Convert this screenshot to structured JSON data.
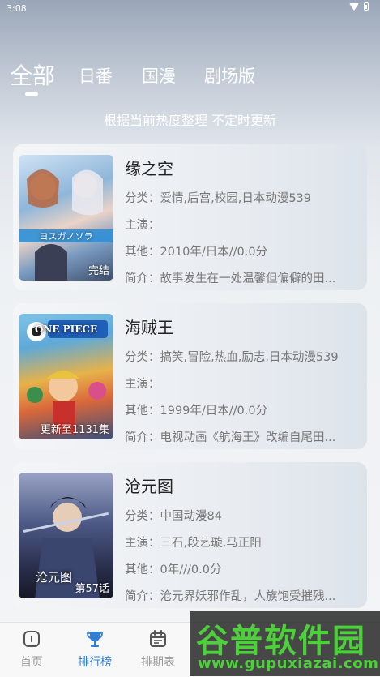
{
  "status_bar": {
    "time": "3:08"
  },
  "tabs": [
    {
      "label": "全部",
      "active": true
    },
    {
      "label": "日番",
      "active": false
    },
    {
      "label": "国漫",
      "active": false
    },
    {
      "label": "剧场版",
      "active": false
    }
  ],
  "subtitle": "根据当前热度整理 不定时更新",
  "items": [
    {
      "title": "缘之空",
      "poster_badge": "完结",
      "poster_text": "ヨスガノソラ",
      "category": "分类：爱情,后宫,校园,日本动漫539",
      "cast": "主演：",
      "other": "其他：2010年/日本//0.0分",
      "summary": "简介：故事发生在一处温馨但偏僻的田..."
    },
    {
      "title": "海贼王",
      "poster_badge": "更新至1131集",
      "poster_text": "ONE PIECE",
      "category": "分类：搞笑,冒险,热血,励志,日本动漫539",
      "cast": "主演：",
      "other": "其他：1999年/日本//0.0分",
      "summary": "简介：电视动画《航海王》改编自尾田..."
    },
    {
      "title": "沧元图",
      "poster_badge": "第57话",
      "poster_text": "沧元图",
      "category": "分类：中国动漫84",
      "cast": "主演：三石,段艺璇,马正阳",
      "other": "其他：0年///0.0分",
      "summary": "简介：沧元界妖邪作乱，人族饱受摧残..."
    }
  ],
  "bottom_nav": [
    {
      "label": "首页",
      "icon": "home-icon",
      "active": false
    },
    {
      "label": "排行榜",
      "icon": "trophy-icon",
      "active": true
    },
    {
      "label": "排期表",
      "icon": "calendar-icon",
      "active": false
    }
  ],
  "watermark": {
    "logo": "谷普软件园",
    "url": "www.gupuxiazai.com"
  },
  "colors": {
    "accent": "#2f7fd6",
    "inactive": "#999999",
    "watermark_green": "#4cd13a"
  }
}
